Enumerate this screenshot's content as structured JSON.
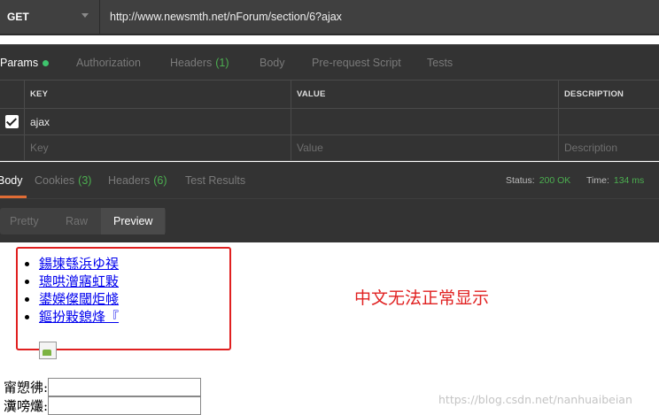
{
  "request": {
    "method": "GET",
    "url": "http://www.newsmth.net/nForum/section/6?ajax"
  },
  "request_tabs": [
    {
      "label": "Params",
      "count": "",
      "active": true
    },
    {
      "label": "Authorization",
      "count": ""
    },
    {
      "label": "Headers",
      "count": "(1)"
    },
    {
      "label": "Body",
      "count": ""
    },
    {
      "label": "Pre-request Script",
      "count": ""
    },
    {
      "label": "Tests",
      "count": ""
    }
  ],
  "params": {
    "headers": {
      "key": "KEY",
      "value": "VALUE",
      "description": "DESCRIPTION"
    },
    "rows": [
      {
        "checked": true,
        "key": "ajax",
        "value": "",
        "description": ""
      }
    ],
    "placeholders": {
      "key": "Key",
      "value": "Value",
      "description": "Description"
    }
  },
  "response_tabs": [
    {
      "label": "Body",
      "count": "",
      "active": true
    },
    {
      "label": "Cookies",
      "count": "(3)"
    },
    {
      "label": "Headers",
      "count": "(6)"
    },
    {
      "label": "Test Results",
      "count": ""
    }
  ],
  "status": {
    "status_label": "Status:",
    "status_value": "200 OK",
    "time_label": "Time:",
    "time_value": "134 ms"
  },
  "view_modes": [
    {
      "label": "Pretty"
    },
    {
      "label": "Raw"
    },
    {
      "label": "Preview",
      "active": true
    }
  ],
  "preview": {
    "links": [
      "鍚堜綔浜ゆ祦",
      "璁哄潧寤虹敤",
      "鍙嬫儏閾炬帴",
      "鏂扮敤鎴烽『"
    ],
    "annotation": "中文无法正常显示",
    "form_labels": [
      "甯愬彿:",
      "瀵嗙爜:"
    ],
    "watermark": "https://blog.csdn.net/nanhuaibeian"
  },
  "colors": {
    "accent_underline": "#e06c35",
    "count_green": "#4caf50",
    "annotation_red": "#e02020"
  }
}
